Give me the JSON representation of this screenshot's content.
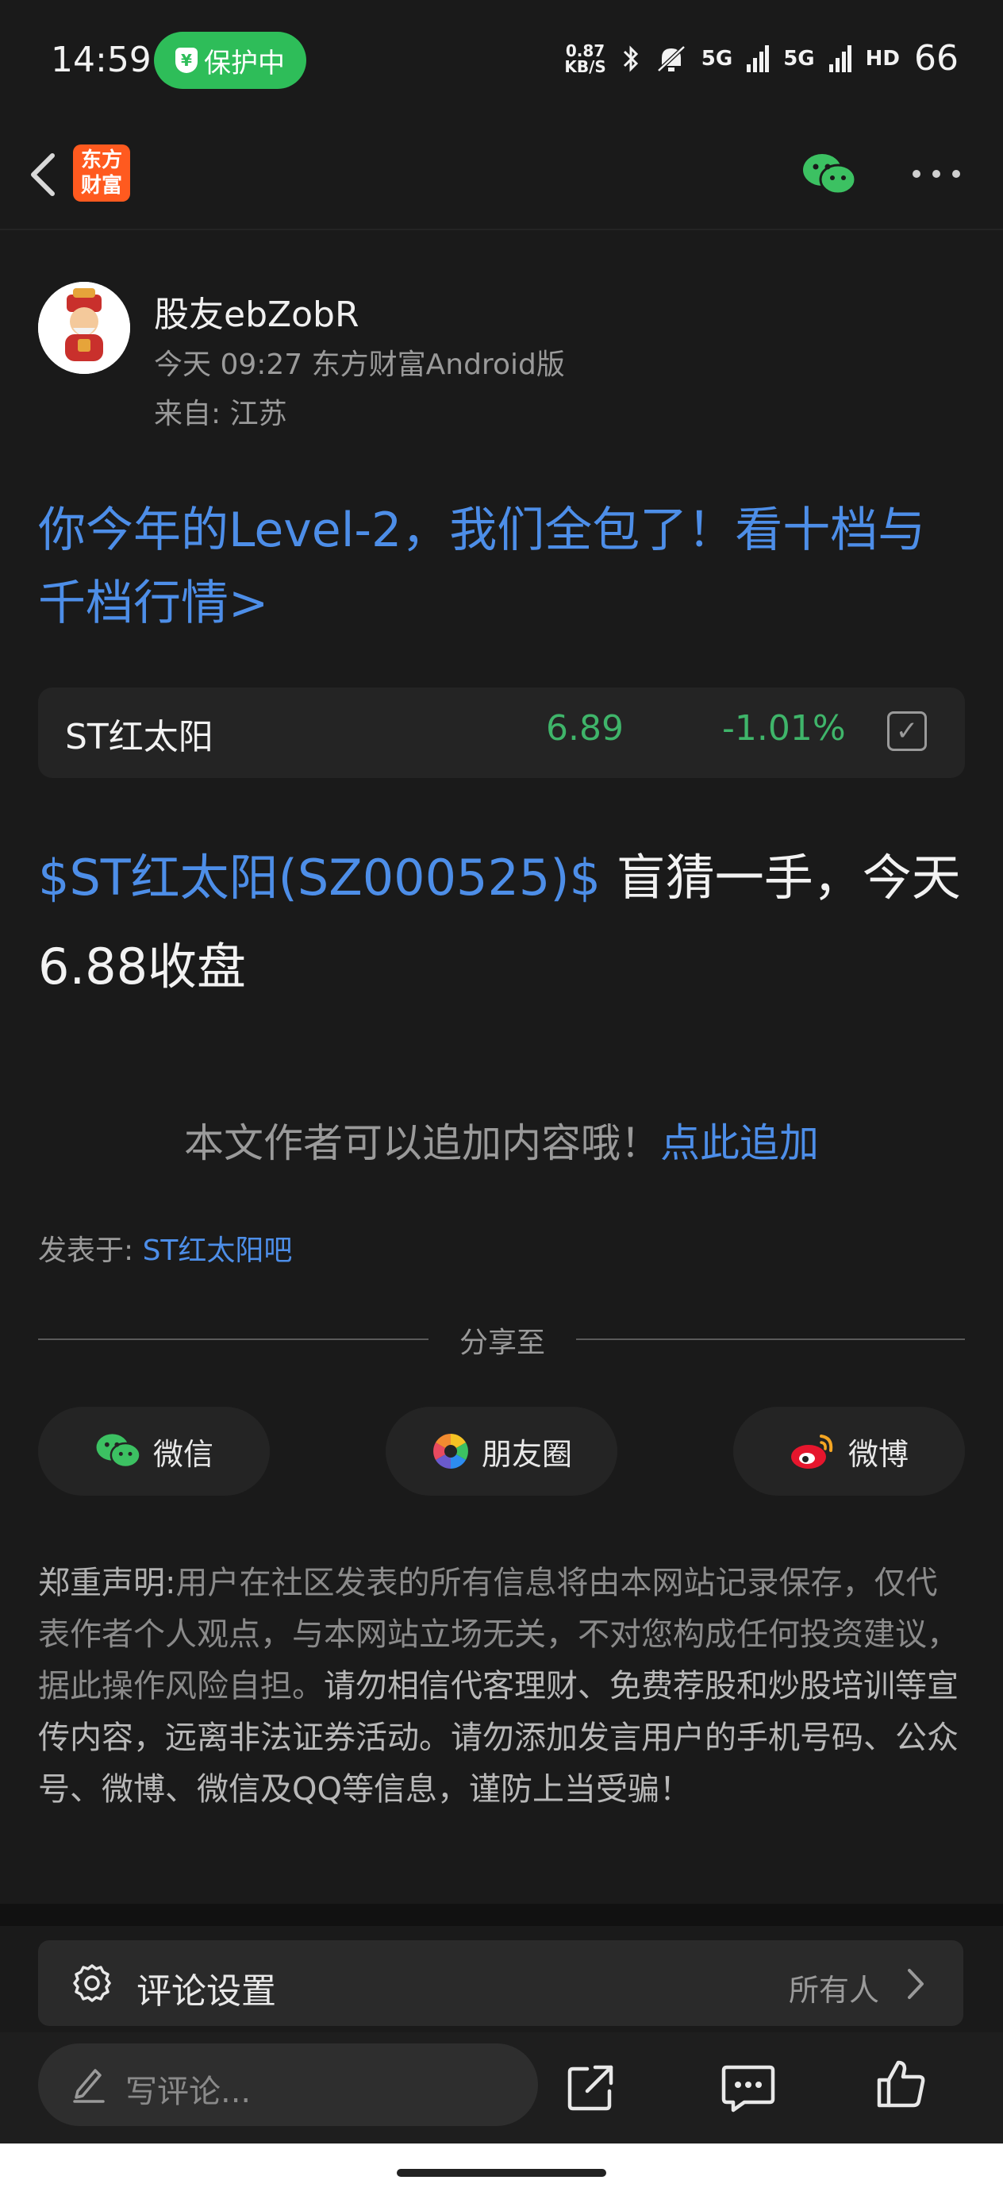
{
  "status_bar": {
    "time": "14:59",
    "protect_label": "保护中",
    "net_speed_value": "0.87",
    "net_speed_unit": "KB/S",
    "signal1": "5G",
    "signal2": "5G",
    "hd": "HD",
    "battery": "66",
    "icons": [
      "bluetooth-icon",
      "mute-icon",
      "signal-icon",
      "signal-icon",
      "battery-icon"
    ]
  },
  "header": {
    "logo_line1": "东方",
    "logo_line2": "财富"
  },
  "author": {
    "name": "股友ebZobR",
    "meta": "今天 09:27 东方财富Android版",
    "location": "来自: 江苏"
  },
  "promo": {
    "text": "你今年的Level-2，我们全包了！看十档与千档行情>"
  },
  "stock_card": {
    "name": "ST红太阳",
    "price": "6.89",
    "change": "-1.01%"
  },
  "post": {
    "stock_link": "$ST红太阳(SZ000525)$",
    "text": " 盲猜一手，今天6.88收盘"
  },
  "append": {
    "text": "本文作者可以追加内容哦！",
    "link": "点此追加"
  },
  "posted_in": {
    "label": "发表于: ",
    "bar": "ST红太阳吧"
  },
  "share": {
    "title": "分享至",
    "wechat": "微信",
    "moments": "朋友圈",
    "weibo": "微博"
  },
  "disclaimer": {
    "title": "郑重声明:",
    "part1": "用户在社区发表的所有信息将由本网站记录保存，仅代表作者个人观点，与本网站立场无关，不对您构成任何投资建议，据此操作风险自担。",
    "part2": "请勿相信代客理财、免费荐股和炒股培训等宣传内容，远离非法证券活动。请勿添加发言用户的手机号码、公众号、微博、微信及QQ等信息，谨防上当受骗！"
  },
  "comment_settings": {
    "label": "评论设置",
    "value": "所有人"
  },
  "bottom_bar": {
    "placeholder": "写评论..."
  },
  "colors": {
    "accent_blue": "#4d8ee8",
    "down_green": "#3fb56a",
    "protect_green": "#2ebd59",
    "logo_orange": "#ff5a1f"
  }
}
